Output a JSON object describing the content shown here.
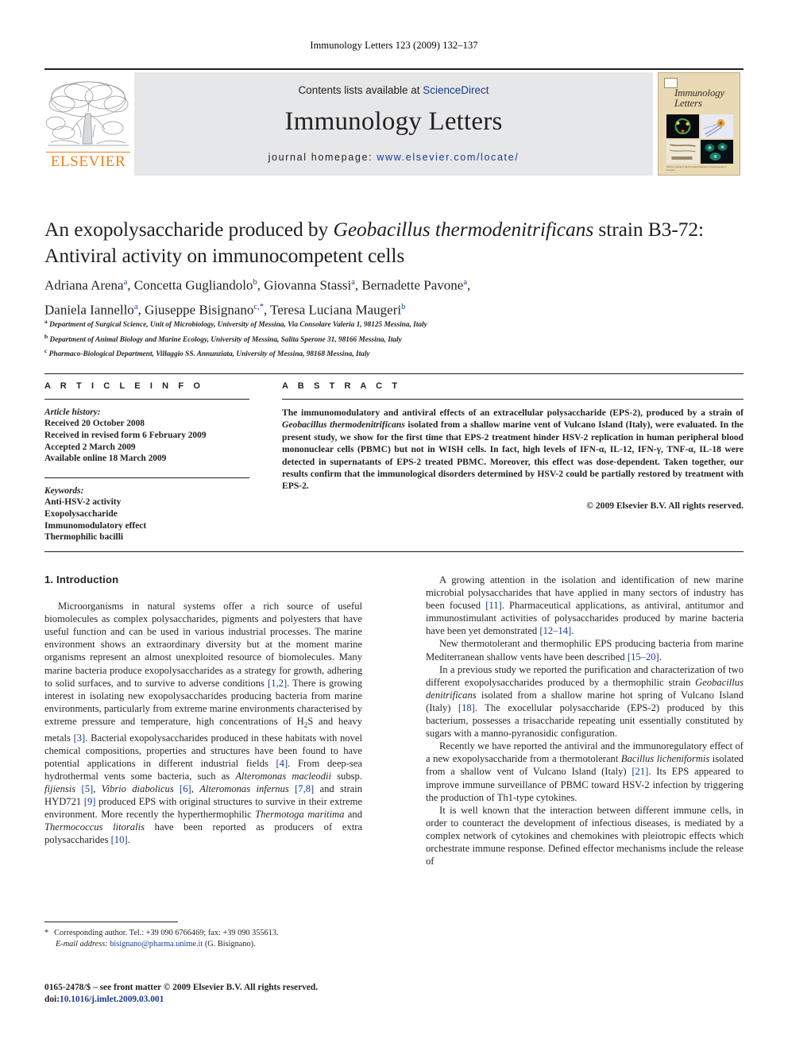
{
  "running_head": "Immunology Letters 123 (2009) 132–137",
  "masthead": {
    "contents_prefix": "Contents lists available at ",
    "contents_link": "ScienceDirect",
    "journal_title": "Immunology Letters",
    "homepage_prefix": "journal homepage: ",
    "homepage_url": "www.elsevier.com/locate/",
    "publisher_name": "ELSEVIER",
    "cover_wordmark": "Immunology Letters",
    "cover_caption": "Official Journal of the European Federation of Immunological Societies"
  },
  "article": {
    "title_line1_a": "An exopolysaccharide produced by ",
    "title_line1_italic": "Geobacillus thermodenitrificans",
    "title_line1_b": " strain B3-72:",
    "title_line2": "Antiviral activity on immunocompetent cells",
    "authors": [
      {
        "name": "Adriana Arena",
        "sup": "a",
        "sep": ", "
      },
      {
        "name": "Concetta Gugliandolo",
        "sup": "b",
        "sep": ", "
      },
      {
        "name": "Giovanna Stassi",
        "sup": "a",
        "sep": ", "
      },
      {
        "name": "Bernadette Pavone",
        "sup": "a",
        "sep": ","
      },
      {
        "name": "Daniela Iannello",
        "sup": "a",
        "sep": ", "
      },
      {
        "name": "Giuseppe Bisignano",
        "sup": "c,*",
        "sep": ", "
      },
      {
        "name": "Teresa Luciana Maugeri",
        "sup": "b",
        "sep": ""
      }
    ],
    "affiliations": [
      {
        "mark": "a",
        "text": "Department of Surgical Science, Unit of Microbiology, University of Messina, Via Consolare Valeria 1, 98125 Messina, Italy"
      },
      {
        "mark": "b",
        "text": "Department of Animal Biology and Marine Ecology, University of Messina, Salita Sperone 31, 98166 Messina, Italy"
      },
      {
        "mark": "c",
        "text": "Pharmaco-Biological Department, Villaggio SS. Annunziata, University of Messina, 98168 Messina, Italy"
      }
    ]
  },
  "article_info": {
    "heading": "A R T I C L E    I N F O",
    "history_label": "Article history:",
    "history": [
      "Received 20 October 2008",
      "Received in revised form 6 February 2009",
      "Accepted 2 March 2009",
      "Available online 18 March 2009"
    ],
    "keywords_label": "Keywords:",
    "keywords": [
      "Anti-HSV-2 activity",
      "Exopolysaccharide",
      "Immunomodulatory effect",
      "Thermophilic bacilli"
    ]
  },
  "abstract": {
    "heading": "A B S T R A C T",
    "part1": "The immunomodulatory and antiviral effects of an extracellular polysaccharide (EPS-2), produced by a strain of ",
    "organism": "Geobacillus thermodenitrificans",
    "part2": " isolated from a shallow marine vent of Vulcano Island (Italy), were evaluated. In the present study, we show for the first time that EPS-2 treatment hinder HSV-2 replication in human peripheral blood mononuclear cells (PBMC) but not in WISH cells. In fact, high levels of IFN-α, IL-12, IFN-γ, TNF-α, IL-18 were detected in supernatants of EPS-2 treated PBMC. Moreover, this effect was dose-dependent. Taken together, our results confirm that the immunological disorders determined by HSV-2 could be partially restored by treatment with EPS-2.",
    "copyright": "© 2009 Elsevier B.V. All rights reserved."
  },
  "introduction": {
    "heading": "1.  Introduction",
    "left_p1_a": "Microorganisms in natural systems offer a rich source of useful biomolecules as complex polysaccharides, pigments and polyesters that have useful function and can be used in various industrial processes. The marine environment shows an extraordinary diversity but at the moment marine organisms represent an almost unexploited resource of biomolecules. Many marine bacteria produce exopolysaccharides as a strategy for growth, adhering to solid surfaces, and to survive to adverse conditions ",
    "left_ref_12": "[1,2]",
    "left_p1_b": ". There is growing interest in isolating new exopolysaccharides producing bacteria from marine environments, particularly from extreme marine environments characterised by extreme pressure and temperature, high concentrations of H",
    "left_sub2": "2",
    "left_p1_c": "S and heavy metals ",
    "left_ref_3": "[3]",
    "left_p1_d": ". Bacterial exopolysaccharides produced in these habitats with novel chemical compositions, properties and structures have been found to have potential applications in different industrial fields ",
    "left_ref_4": "[4]",
    "left_p1_e": ". From deep-sea hydrothermal vents some bacteria, such as ",
    "left_it_1": "Alteromonas macleodii",
    "left_p1_f": " subsp. ",
    "left_it_2": "fijiensis",
    "left_ref_5": " [5]",
    "left_p1_g": ", ",
    "left_it_3": "Vibrio diabolicus",
    "left_ref_6": " [6]",
    "left_p1_h": ", ",
    "left_it_4": "Alteromonas infernus",
    "left_ref_78": " [7,8]",
    "left_p1_i": " and strain HYD721 ",
    "left_ref_9": "[9]",
    "left_p1_j": " produced EPS with original structures to survive in their extreme environment. More recently the hyperthermophilic ",
    "left_it_5": "Thermotoga maritima",
    "left_p1_k": " and ",
    "left_it_6": "Thermococcus litoralis",
    "left_p1_l": " have been reported as producers of extra polysaccharides ",
    "left_ref_10": "[10]",
    "left_p1_m": ".",
    "right_p1_a": "A growing attention in the isolation and identification of new marine microbial polysaccharides that have applied in many sectors of industry has been focused ",
    "right_ref_11": "[11]",
    "right_p1_b": ". Pharmaceutical applications, as antiviral, antitumor and immunostimulant activities of polysaccharides produced by marine bacteria have been yet demonstrated ",
    "right_ref_1214": "[12–14]",
    "right_p1_c": ".",
    "right_p2_a": "New thermotolerant and thermophilic EPS producing bacteria from marine Mediterranean shallow vents have been described ",
    "right_ref_1520": "[15–20]",
    "right_p2_b": ".",
    "right_p3_a": "In a previous study we reported the purification and characterization of two different exopolysaccharides produced by a thermophilic strain ",
    "right_it_1": "Geobacillus denitrificans",
    "right_p3_b": " isolated from a shallow marine hot spring of Vulcano Island (Italy) ",
    "right_ref_18": "[18]",
    "right_p3_c": ". The exocellular polysaccharide (EPS-2) produced by this bacterium, possesses a trisaccharide repeating unit essentially constituted by sugars with a manno-pyranosidic configuration.",
    "right_p4_a": "Recently we have reported the antiviral and the immunoregulatory effect of a new exopolysaccharide from a thermotolerant ",
    "right_it_2": "Bacillus licheniformis",
    "right_p4_b": " isolated from a shallow vent of Vulcano Island (Italy) ",
    "right_ref_21": "[21]",
    "right_p4_c": ". Its EPS appeared to improve immune surveillance of PBMC toward HSV-2 infection by triggering the production of Th1-type cytokines.",
    "right_p5": "It is well known that the interaction between different immune cells, in order to counteract the development of infectious diseases, is mediated by a complex network of cytokines and chemokines with pleiotropic effects which orchestrate immune response. Defined effector mechanisms include the release of"
  },
  "footnote": {
    "star": "*",
    "corresponding": "Corresponding author. Tel.: +39 090 6766469; fax: +39 090 355613.",
    "email_label": "E-mail address:",
    "email": "bisignano@pharma.unime.it",
    "email_owner": "(G. Bisignano)."
  },
  "colophon": {
    "issn_line": "0165-2478/$ – see front matter © 2009 Elsevier B.V. All rights reserved.",
    "doi_label": "doi:",
    "doi": "10.1016/j.imlet.2009.03.001"
  },
  "colors": {
    "elsevier_orange": "#f07f1a",
    "link_blue": "#1a3a8f",
    "masthead_grey": "#e6e7e8",
    "cover_tan": "#e9d9b4"
  }
}
